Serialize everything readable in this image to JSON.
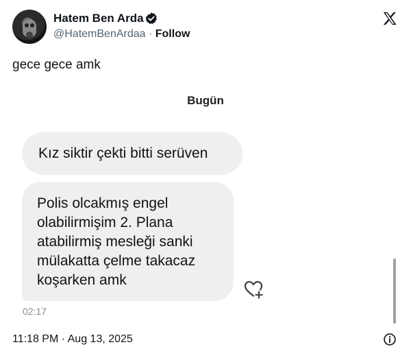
{
  "author": {
    "display_name": "Hatem Ben Arda",
    "handle": "@HatemBenArdaa",
    "separator": " · ",
    "follow_label": "Follow"
  },
  "tweet": {
    "text": "gece gece amk",
    "timestamp": "11:18 PM · Aug 13, 2025"
  },
  "embedded_chat": {
    "date_separator": "Bugün",
    "messages": [
      {
        "lines": [
          "Kız siktir çekti bitti serüven"
        ]
      },
      {
        "lines": [
          "Polis olcakmış engel",
          "olabilirmişim 2. Plana",
          "atabilirmiş mesleği sanki",
          "mülakatta çelme takacaz",
          "koşarken amk"
        ]
      }
    ],
    "message_time": "02:17"
  },
  "icons": {
    "verified": "verified-badge-icon",
    "brand": "x-logo-icon",
    "react": "heart-plus-icon",
    "info": "info-icon"
  },
  "colors": {
    "text": "#0f1419",
    "secondary_text": "#536471",
    "bubble": "#efefef"
  }
}
